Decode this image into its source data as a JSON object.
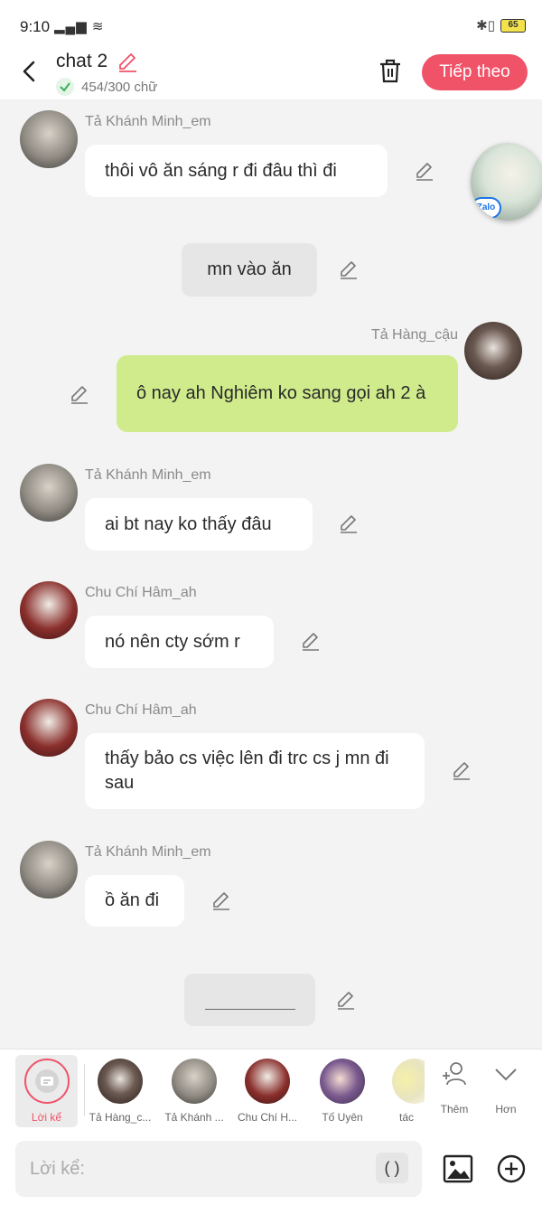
{
  "status_bar": {
    "time": "9:10",
    "battery": "65"
  },
  "header": {
    "title": "chat 2",
    "char_count": "454/300 chữ",
    "next_label": "Tiếp theo"
  },
  "messages": [
    {
      "sender": "Tả Khánh Minh_em",
      "text": "thôi vô ăn sáng r đi đâu thì đi"
    },
    {
      "text": "mn vào ăn"
    },
    {
      "sender": "Tả Hàng_cậu",
      "text": "ô nay ah Nghiêm ko sang gọi ah 2 à"
    },
    {
      "sender": "Tả Khánh Minh_em",
      "text": "ai bt nay ko thấy đâu"
    },
    {
      "sender": "Chu Chí Hâm_ah",
      "text": "nó nên cty sớm r"
    },
    {
      "sender": "Chu Chí Hâm_ah",
      "text": "thấy bảo cs việc lên đi trc cs j mn đi sau"
    },
    {
      "sender": "Tả Khánh Minh_em",
      "text": "ồ ăn đi"
    },
    {
      "text": ""
    }
  ],
  "floating": {
    "badge": "Zalo"
  },
  "characters": {
    "narrator": "Lời kể",
    "items": [
      "Tả Hàng_c...",
      "Tả Khánh ...",
      "Chu Chí H...",
      "Tố Uyên",
      "tác"
    ],
    "add_label": "Thêm",
    "more_label": "Hơn"
  },
  "input": {
    "placeholder": "Lời kể:",
    "paren": "( )"
  },
  "colors": {
    "accent": "#f05268",
    "mine_bubble": "#cfeb8b",
    "narration_bubble": "#e6e6e6"
  }
}
